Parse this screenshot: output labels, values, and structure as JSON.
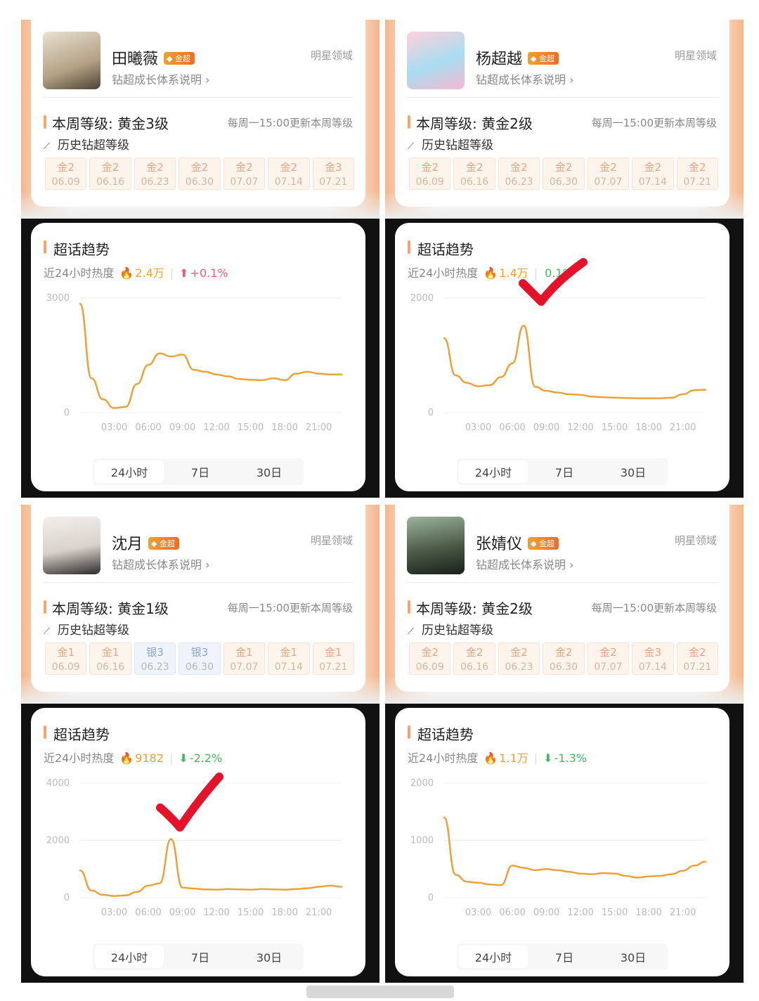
{
  "domain_label": "明星领域",
  "subtitle": "钻超成长体系说明 ›",
  "badge_label": "金超",
  "update_note": "每周一15:00更新本周等级",
  "history_label": "历史钻超等级",
  "trend_title": "超话趋势",
  "heat_label": "近24小时热度",
  "tabs": [
    "24小时",
    "7日",
    "30日"
  ],
  "x_ticks": [
    "03:00",
    "06:00",
    "09:00",
    "12:00",
    "15:00",
    "18:00",
    "21:00"
  ],
  "colors": {
    "accent": "#f0a030",
    "line": "#eba238",
    "check": "#e5132a",
    "up": "#f05a78",
    "down": "#3fbd5e"
  },
  "icons": {
    "flame": "flame-icon",
    "trend": "trend-icon",
    "arrow_up": "arrow-up-icon",
    "arrow_down": "arrow-down-icon",
    "check": "checkmark-icon"
  },
  "cards": [
    {
      "name": "田曦薇",
      "level": "本周等级: 黄金3级",
      "history": [
        {
          "tier": "金2",
          "date": "06.09"
        },
        {
          "tier": "金2",
          "date": "06.16"
        },
        {
          "tier": "金2",
          "date": "06.23"
        },
        {
          "tier": "金2",
          "date": "06.30"
        },
        {
          "tier": "金2",
          "date": "07.07"
        },
        {
          "tier": "金2",
          "date": "07.14"
        },
        {
          "tier": "金3",
          "date": "07.21"
        }
      ],
      "heat": "2.4万",
      "change": "+0.1%",
      "change_dir": "up"
    },
    {
      "name": "杨超越",
      "level": "本周等级: 黄金2级",
      "history": [
        {
          "tier": "金2",
          "date": "06.09"
        },
        {
          "tier": "金2",
          "date": "06.16"
        },
        {
          "tier": "金2",
          "date": "06.23"
        },
        {
          "tier": "金2",
          "date": "06.30"
        },
        {
          "tier": "金2",
          "date": "07.07"
        },
        {
          "tier": "金2",
          "date": "07.14"
        },
        {
          "tier": "金2",
          "date": "07.21"
        }
      ],
      "heat": "1.4万",
      "change": "0.1%",
      "change_dir": "up"
    },
    {
      "name": "沈月",
      "level": "本周等级: 黄金1级",
      "history": [
        {
          "tier": "金1",
          "date": "06.09"
        },
        {
          "tier": "金1",
          "date": "06.16"
        },
        {
          "tier": "银3",
          "date": "06.23"
        },
        {
          "tier": "银3",
          "date": "06.30"
        },
        {
          "tier": "金1",
          "date": "07.07"
        },
        {
          "tier": "金1",
          "date": "07.14"
        },
        {
          "tier": "金1",
          "date": "07.21"
        }
      ],
      "heat": "9182",
      "change": "-2.2%",
      "change_dir": "down"
    },
    {
      "name": "张婧仪",
      "level": "本周等级: 黄金2级",
      "history": [
        {
          "tier": "金2",
          "date": "06.09"
        },
        {
          "tier": "金2",
          "date": "06.16"
        },
        {
          "tier": "金2",
          "date": "06.23"
        },
        {
          "tier": "金2",
          "date": "06.30"
        },
        {
          "tier": "金2",
          "date": "07.07"
        },
        {
          "tier": "金3",
          "date": "07.14"
        },
        {
          "tier": "金2",
          "date": "07.21"
        }
      ],
      "heat": "1.1万",
      "change": "-1.3%",
      "change_dir": "down"
    }
  ],
  "chart_data": [
    {
      "type": "line",
      "y_ticks": [
        "3000",
        "0"
      ],
      "ylim": [
        0,
        3000
      ],
      "x": [
        0,
        1,
        2,
        3,
        4,
        5,
        6,
        7,
        8,
        9,
        10,
        11,
        12,
        13,
        14,
        15,
        16,
        17,
        18,
        19,
        20,
        21,
        22,
        23
      ],
      "values": [
        2850,
        900,
        350,
        120,
        150,
        750,
        1250,
        1550,
        1470,
        1520,
        1120,
        1070,
        1000,
        950,
        880,
        860,
        850,
        900,
        850,
        1020,
        1070,
        1020,
        1000,
        1000
      ]
    },
    {
      "type": "line",
      "y_ticks": [
        "2000",
        "0"
      ],
      "ylim": [
        0,
        2000
      ],
      "x": [
        0,
        1,
        2,
        3,
        4,
        5,
        6,
        7,
        8,
        9,
        10,
        11,
        12,
        13,
        14,
        15,
        16,
        17,
        18,
        19,
        20,
        21,
        22,
        23
      ],
      "values": [
        1300,
        650,
        520,
        460,
        480,
        620,
        860,
        1520,
        450,
        380,
        350,
        320,
        310,
        280,
        270,
        260,
        255,
        250,
        250,
        250,
        260,
        320,
        390,
        400
      ]
    },
    {
      "type": "line",
      "y_ticks": [
        "4000",
        "2000",
        "0"
      ],
      "ylim": [
        0,
        4000
      ],
      "x": [
        0,
        1,
        2,
        3,
        4,
        5,
        6,
        7,
        8,
        9,
        10,
        11,
        12,
        13,
        14,
        15,
        16,
        17,
        18,
        19,
        20,
        21,
        22,
        23
      ],
      "values": [
        950,
        250,
        100,
        60,
        80,
        200,
        420,
        500,
        2050,
        350,
        320,
        290,
        280,
        300,
        290,
        280,
        300,
        290,
        280,
        300,
        330,
        380,
        420,
        380
      ]
    },
    {
      "type": "line",
      "y_ticks": [
        "2000",
        "1000",
        "0"
      ],
      "ylim": [
        0,
        2000
      ],
      "x": [
        0,
        1,
        2,
        3,
        4,
        5,
        6,
        7,
        8,
        9,
        10,
        11,
        12,
        13,
        14,
        15,
        16,
        17,
        18,
        19,
        20,
        21,
        22,
        23
      ],
      "values": [
        1400,
        400,
        280,
        260,
        230,
        220,
        560,
        520,
        480,
        500,
        480,
        450,
        420,
        410,
        430,
        420,
        380,
        350,
        370,
        380,
        410,
        470,
        560,
        630
      ]
    }
  ]
}
